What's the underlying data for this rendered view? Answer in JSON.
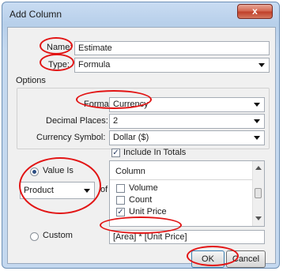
{
  "window": {
    "title": "Add Column",
    "close_glyph": "x"
  },
  "name": {
    "label": "Name:",
    "value": "Estimate"
  },
  "type": {
    "label": "Type:",
    "value": "Formula"
  },
  "options": {
    "group_label": "Options",
    "format": {
      "label": "Format:",
      "value": "Currency"
    },
    "decimal_places": {
      "label": "Decimal Places:",
      "value": "2"
    },
    "currency_symbol": {
      "label": "Currency Symbol:",
      "value": "Dollar ($)"
    },
    "include_in_totals": {
      "label": "Include In Totals",
      "checked": true
    }
  },
  "value_is": {
    "label": "Value Is",
    "selected": true,
    "operation": "Product",
    "of_label": "of"
  },
  "column_list": {
    "header": "Column",
    "items": [
      {
        "label": "Volume",
        "checked": false
      },
      {
        "label": "Count",
        "checked": false
      },
      {
        "label": "Unit Price",
        "checked": true
      }
    ]
  },
  "custom": {
    "label": "Custom",
    "selected": false,
    "formula": "[Area] * [Unit Price]"
  },
  "buttons": {
    "ok": "OK",
    "cancel": "Cancel"
  },
  "colors": {
    "annotation": "#e21414",
    "title_bar": "#b7cfea"
  }
}
